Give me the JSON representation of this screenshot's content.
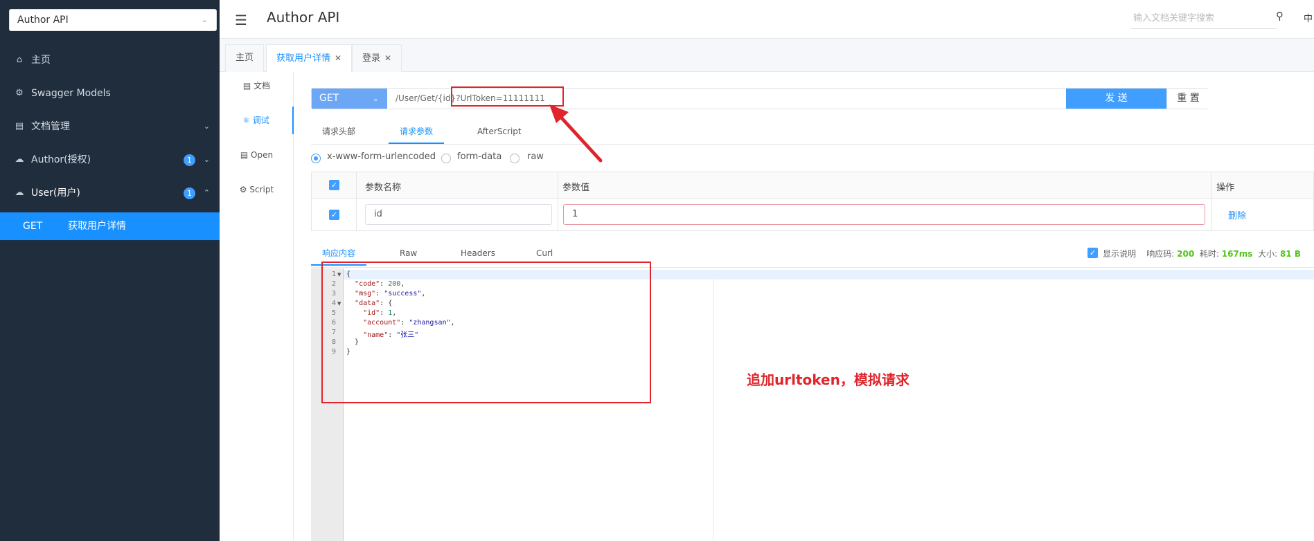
{
  "sidebar": {
    "api_select": "Author API",
    "items": [
      {
        "label": "主页",
        "icon": "home-icon"
      },
      {
        "label": "Swagger Models",
        "icon": "gear-icon"
      },
      {
        "label": "文档管理",
        "icon": "document-icon"
      },
      {
        "label": "Author(授权)",
        "icon": "cloud-icon",
        "badge": "1"
      },
      {
        "label": "User(用户)",
        "icon": "cloud-icon",
        "badge": "1"
      }
    ],
    "active_sub": {
      "method": "GET",
      "name": "获取用户详情"
    }
  },
  "header": {
    "title": "Author API",
    "search_placeholder": "输入文档关键字搜索",
    "lang": "中"
  },
  "tabs": [
    {
      "label": "主页"
    },
    {
      "label": "获取用户详情",
      "active": true
    },
    {
      "label": "登录"
    }
  ],
  "vnav": [
    {
      "label": "文档",
      "icon": "document-icon"
    },
    {
      "label": "调试",
      "icon": "bug-icon",
      "active": true
    },
    {
      "label": "Open",
      "icon": "file-icon"
    },
    {
      "label": "Script",
      "icon": "gear-icon"
    }
  ],
  "request": {
    "method": "GET",
    "url": "/User/Get/{id}?UrlToken=11111111",
    "send_label": "发 送",
    "reset_label": "重 置"
  },
  "param_tabs": [
    "请求头部",
    "请求参数",
    "AfterScript"
  ],
  "body_types": [
    "x-www-form-urlencoded",
    "form-data",
    "raw"
  ],
  "params_table": {
    "headers": [
      "参数名称",
      "参数值",
      "操作"
    ],
    "rows": [
      {
        "name": "id",
        "value": "1",
        "action": "删除"
      }
    ]
  },
  "response_tabs": [
    "响应内容",
    "Raw",
    "Headers",
    "Curl"
  ],
  "response_meta": {
    "show_desc": "显示说明",
    "code_label": "响应码:",
    "code": "200",
    "time_label": "耗时:",
    "time": "167ms",
    "size_label": "大小:",
    "size": "81 B"
  },
  "response_body": {
    "line_numbers": [
      "1",
      "2",
      "3",
      "4",
      "5",
      "6",
      "7",
      "8",
      "9"
    ]
  },
  "annotation": {
    "text": "追加urltoken，模拟请求"
  },
  "colors": {
    "sidebar_bg": "#1f2d3d",
    "accent": "#1890ff",
    "annotation": "#e0242b",
    "success": "#52c41a"
  }
}
